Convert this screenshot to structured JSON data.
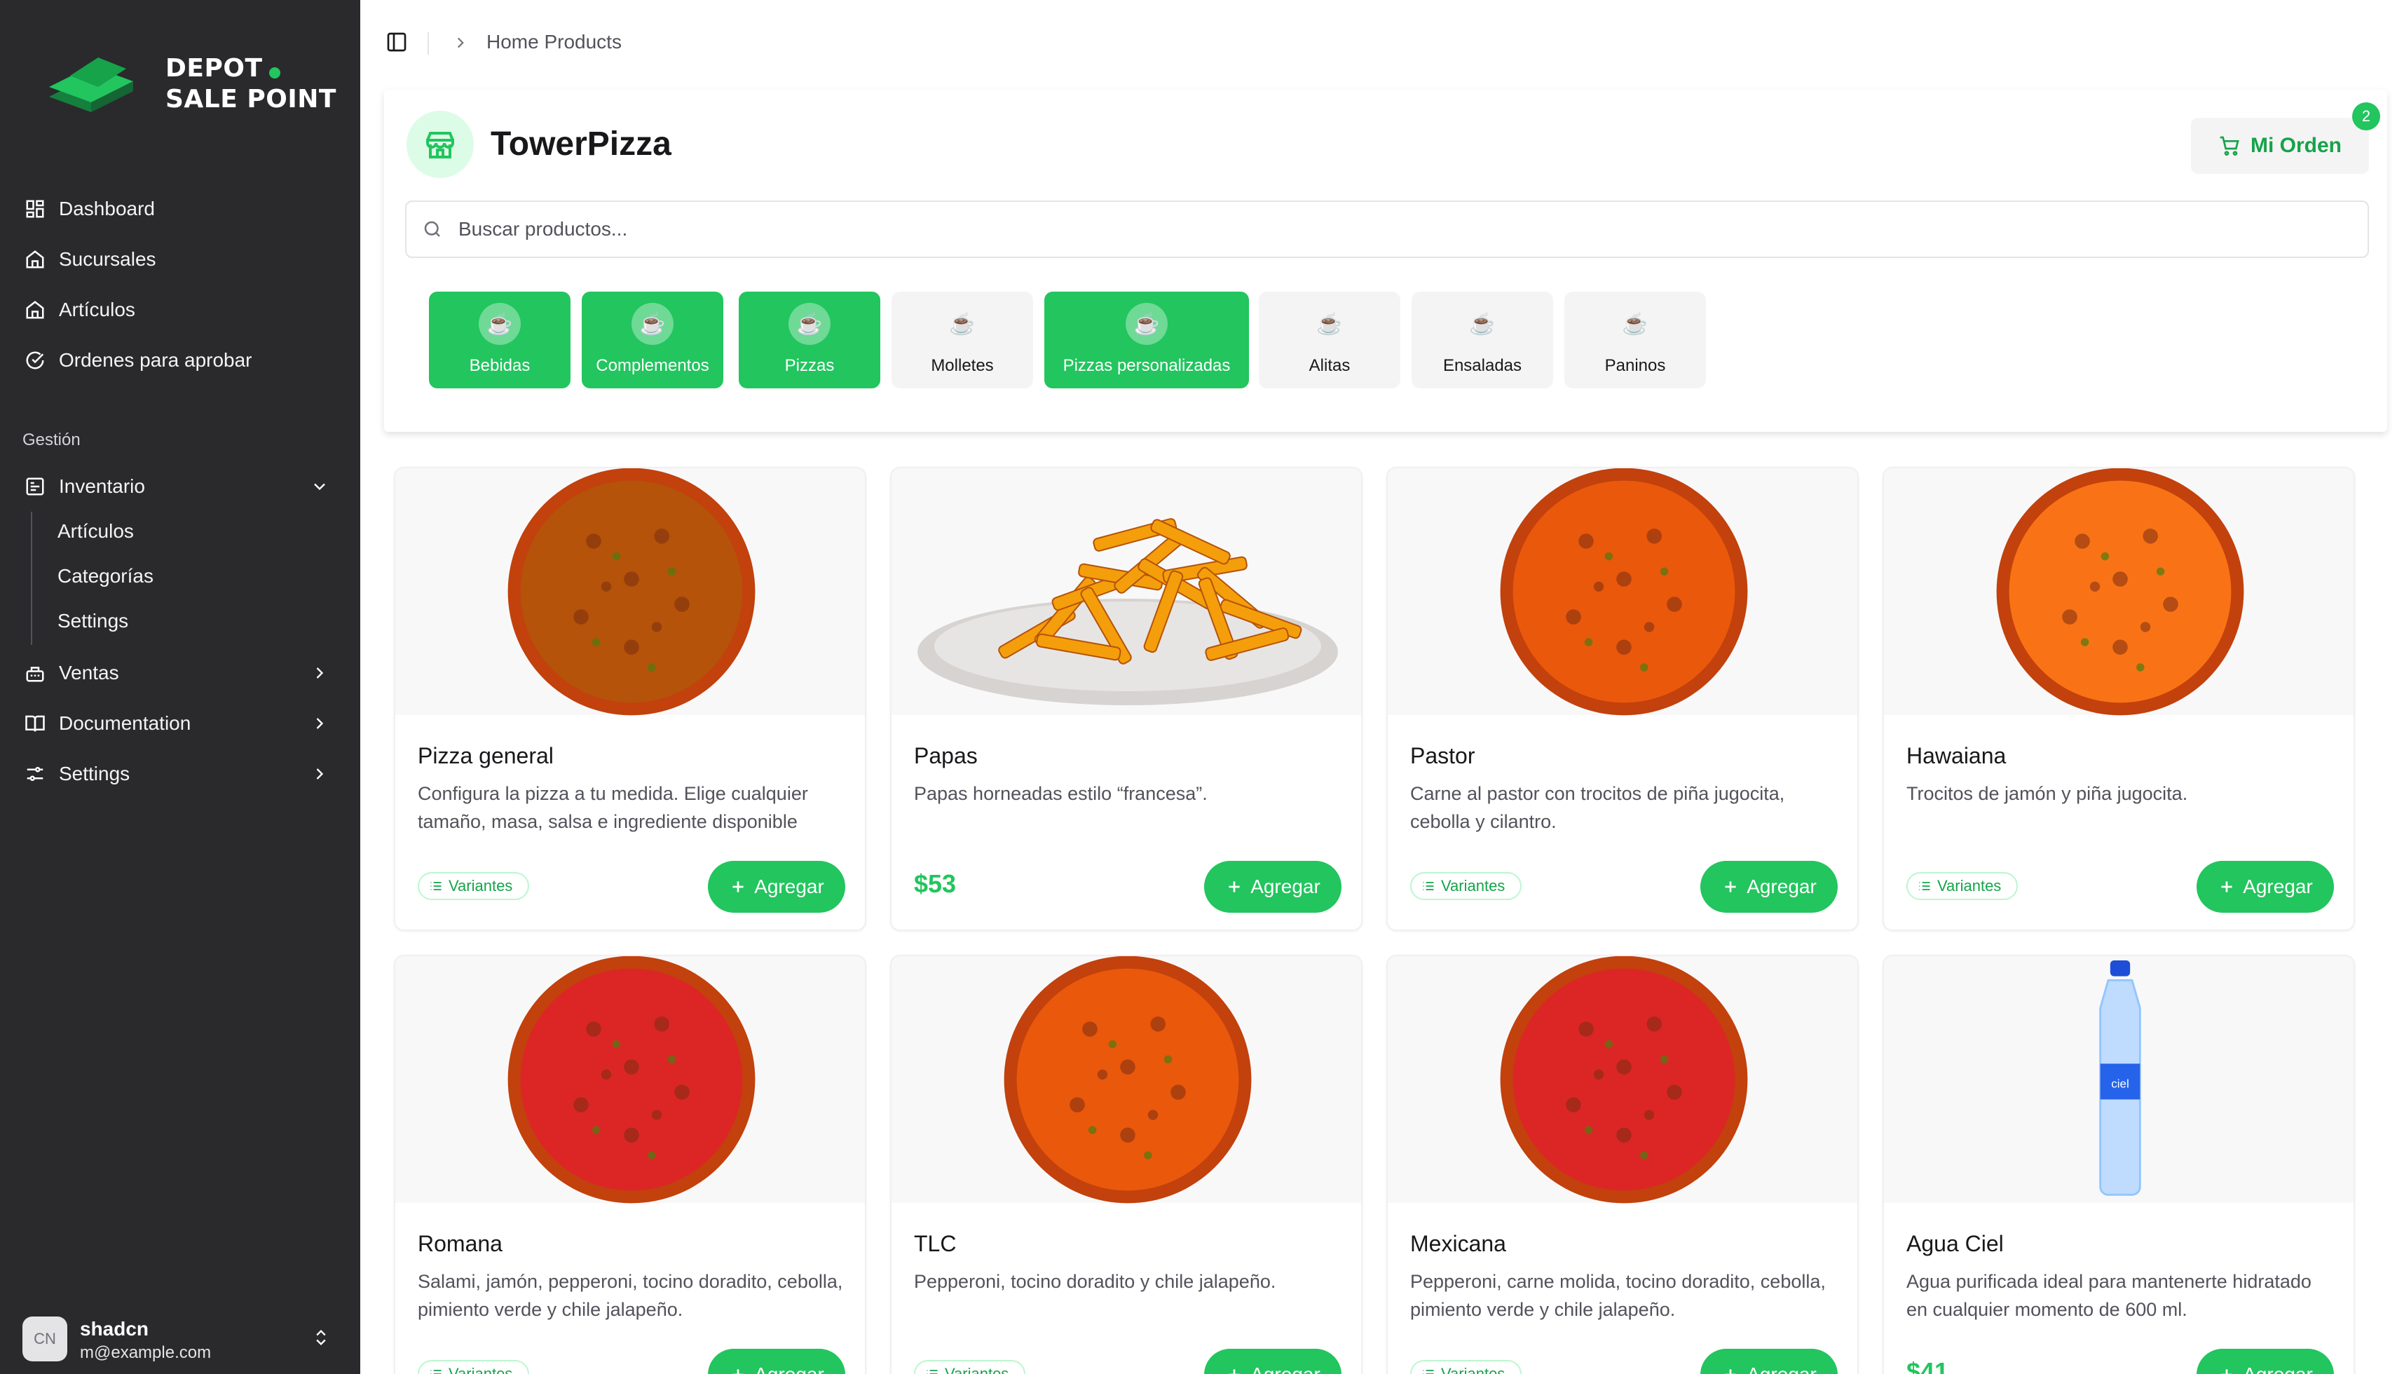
{
  "logo": {
    "line1": "DEPOT",
    "line2": "SALE POINT"
  },
  "nav": {
    "dashboard": "Dashboard",
    "sucursales": "Sucursales",
    "articulos": "Artículos",
    "ordenes": "Ordenes para aprobar",
    "section": "Gestión",
    "inventario": "Inventario",
    "inventario_sub": {
      "articulos": "Artículos",
      "categorias": "Categorías",
      "settings": "Settings"
    },
    "ventas": "Ventas",
    "documentation": "Documentation",
    "settings": "Settings"
  },
  "user": {
    "avatar": "CN",
    "name": "shadcn",
    "email": "m@example.com"
  },
  "breadcrumb": "Home Products",
  "store": {
    "title": "TowerPizza"
  },
  "order": {
    "label": "Mi Orden",
    "count": "2"
  },
  "search": {
    "placeholder": "Buscar productos..."
  },
  "categories": [
    {
      "label": "Bebidas",
      "active": true
    },
    {
      "label": "Complementos",
      "active": true
    },
    {
      "label": "Pizzas",
      "active": true
    },
    {
      "label": "Molletes",
      "active": false
    },
    {
      "label": "Pizzas personalizadas",
      "active": true
    },
    {
      "label": "Alitas",
      "active": false
    },
    {
      "label": "Ensaladas",
      "active": false
    },
    {
      "label": "Paninos",
      "active": false
    }
  ],
  "products": [
    {
      "name": "Pizza general",
      "desc": "Configura la pizza a tu medida. Elige cualquier tamaño, masa, salsa e ingrediente disponible",
      "variants_label": "Variantes",
      "price": "",
      "image": "pizza-image",
      "add": "Agregar"
    },
    {
      "name": "Papas",
      "desc": "Papas horneadas estilo “francesa”.",
      "variants_label": "",
      "price": "$53",
      "image": "fries-image",
      "add": "Agregar"
    },
    {
      "name": "Pastor",
      "desc": "Carne al pastor con trocitos de piña jugocita, cebolla y cilantro.",
      "variants_label": "Variantes",
      "price": "",
      "image": "pizza-image",
      "add": "Agregar"
    },
    {
      "name": "Hawaiana",
      "desc": "Trocitos de jamón y piña jugocita.",
      "variants_label": "Variantes",
      "price": "",
      "image": "pizza-image",
      "add": "Agregar"
    },
    {
      "name": "Romana",
      "desc": "Salami, jamón, pepperoni, tocino doradito, cebolla, pimiento verde y chile jalapeño.",
      "variants_label": "Variantes",
      "price": "",
      "image": "pizza-image",
      "add": "Agregar"
    },
    {
      "name": "TLC",
      "desc": "Pepperoni, tocino doradito y chile jalapeño.",
      "variants_label": "Variantes",
      "price": "",
      "image": "pizza-image",
      "add": "Agregar"
    },
    {
      "name": "Mexicana",
      "desc": "Pepperoni, carne molida, tocino doradito, cebolla, pimiento verde y chile jalapeño.",
      "variants_label": "Variantes",
      "price": "",
      "image": "pizza-image",
      "add": "Agregar"
    },
    {
      "name": "Agua Ciel",
      "desc": "Agua purificada ideal para mantenerte hidratado en cualquier momento de 600 ml.",
      "variants_label": "",
      "price": "$41",
      "image": "water-bottle-image",
      "add": "Agregar"
    }
  ],
  "colors": {
    "accent": "#22c55e",
    "sidebar": "#2a2a2d"
  }
}
